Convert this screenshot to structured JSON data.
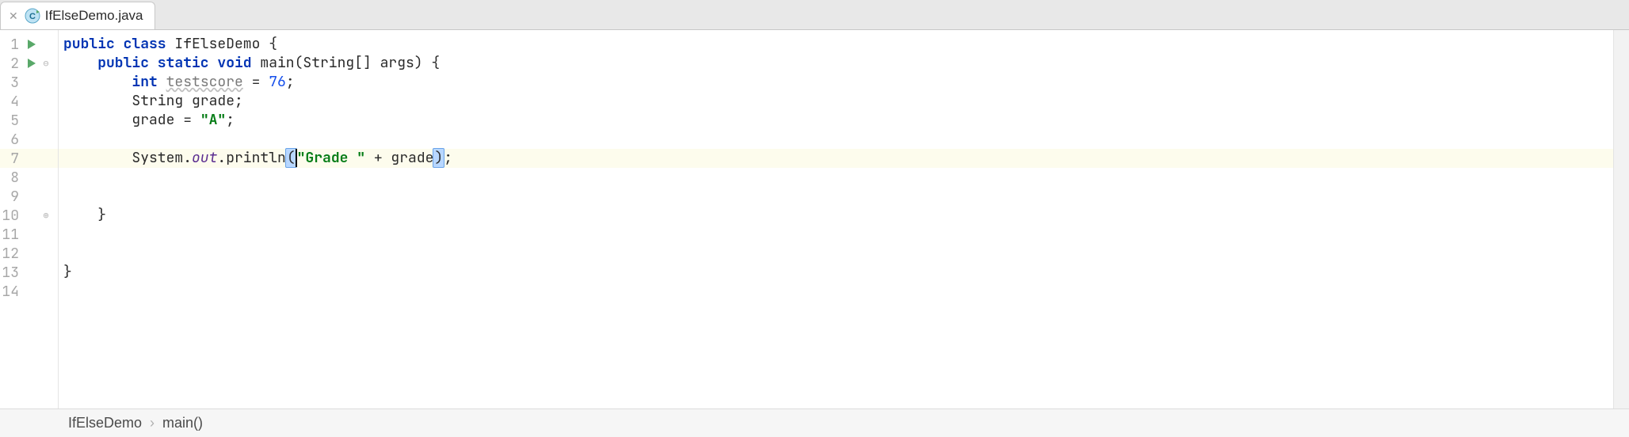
{
  "tab": {
    "filename": "IfElseDemo.java",
    "icon": "java-class-icon"
  },
  "gutter": {
    "line_count": 14,
    "run_markers": [
      1,
      2
    ],
    "fold_open": [
      2
    ],
    "fold_close": [
      10
    ],
    "highlighted_line": 7
  },
  "code": {
    "lines": [
      {
        "n": 1,
        "tokens": [
          {
            "t": "kw",
            "v": "public class"
          },
          {
            "t": "p",
            "v": " IfElseDemo {"
          }
        ]
      },
      {
        "n": 2,
        "indent": "    ",
        "tokens": [
          {
            "t": "kw",
            "v": "public static void"
          },
          {
            "t": "p",
            "v": " main(String[] args) {"
          }
        ]
      },
      {
        "n": 3,
        "indent": "        ",
        "tokens": [
          {
            "t": "kw",
            "v": "int"
          },
          {
            "t": "p",
            "v": " "
          },
          {
            "t": "sq",
            "v": "testscore"
          },
          {
            "t": "p",
            "v": " = "
          },
          {
            "t": "num",
            "v": "76"
          },
          {
            "t": "p",
            "v": ";"
          }
        ]
      },
      {
        "n": 4,
        "indent": "        ",
        "tokens": [
          {
            "t": "p",
            "v": "String grade;"
          }
        ]
      },
      {
        "n": 5,
        "indent": "        ",
        "tokens": [
          {
            "t": "p",
            "v": "grade = "
          },
          {
            "t": "str",
            "v": "\"A\""
          },
          {
            "t": "p",
            "v": ";"
          }
        ]
      },
      {
        "n": 6,
        "indent": "",
        "tokens": []
      },
      {
        "n": 7,
        "indent": "        ",
        "hl": true,
        "tokens": [
          {
            "t": "p",
            "v": "System."
          },
          {
            "t": "fld",
            "v": "out"
          },
          {
            "t": "p",
            "v": ".println"
          },
          {
            "t": "ph",
            "v": "("
          },
          {
            "t": "caret",
            "v": ""
          },
          {
            "t": "str",
            "v": "\"Grade \""
          },
          {
            "t": "p",
            "v": " + grade"
          },
          {
            "t": "ph",
            "v": ")"
          },
          {
            "t": "p",
            "v": ";"
          }
        ]
      },
      {
        "n": 8,
        "indent": "",
        "tokens": []
      },
      {
        "n": 9,
        "indent": "",
        "tokens": []
      },
      {
        "n": 10,
        "indent": "    ",
        "tokens": [
          {
            "t": "p",
            "v": "}"
          }
        ]
      },
      {
        "n": 11,
        "indent": "",
        "tokens": []
      },
      {
        "n": 12,
        "indent": "",
        "tokens": []
      },
      {
        "n": 13,
        "indent": "",
        "tokens": [
          {
            "t": "p",
            "v": "}"
          }
        ]
      },
      {
        "n": 14,
        "indent": "",
        "tokens": []
      }
    ]
  },
  "breadcrumb": {
    "items": [
      "IfElseDemo",
      "main()"
    ]
  }
}
